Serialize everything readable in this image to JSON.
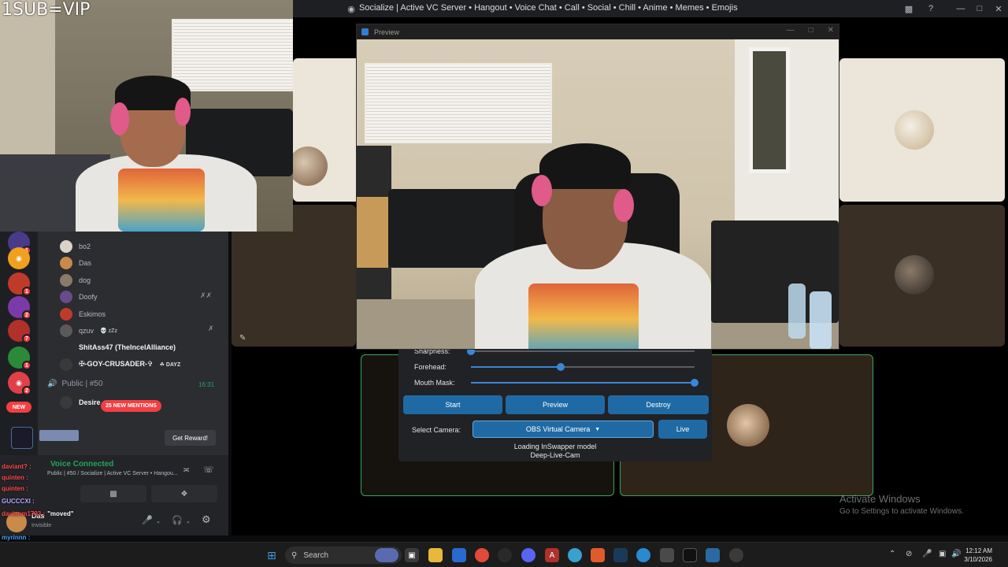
{
  "overlay": {
    "top_text": "1SUB=VIP"
  },
  "window": {
    "title": "Socialize | Active VC Server • Hangout • Voice Chat • Call • Social • Chill • Anime • Memes • Emojis"
  },
  "preview": {
    "title": "Preview"
  },
  "panel": {
    "sharpness_label": "Sharpness:",
    "forehead_label": "Forehead:",
    "mouth_mask_label": "Mouth Mask:",
    "forehead_value": 0.4,
    "mouth_mask_value": 1.0,
    "start_label": "Start",
    "preview_label": "Preview",
    "destroy_label": "Destroy",
    "select_camera_label": "Select Camera:",
    "camera_value": "OBS Virtual Camera",
    "live_label": "Live",
    "status_line1": "Loading InSwapper model",
    "status_line2": "Deep-Live-Cam"
  },
  "voice_users": [
    {
      "name": "bo2",
      "color": "#d9d3c9"
    },
    {
      "name": "Das",
      "color": "#c98a4a"
    },
    {
      "name": "dog",
      "color": "#8c7a68"
    },
    {
      "name": "Doofy",
      "color": "#6a4a8a"
    },
    {
      "name": "Eskimos",
      "color": "#c03a2a"
    },
    {
      "name": "qzuv",
      "color": "#5a5a5a",
      "tag": "💀 zZz"
    },
    {
      "name": "ShitAss47 (TheIncelAlliance)",
      "color": "#2b2d31",
      "bold": true
    },
    {
      "name": "✠-GOY-CRUSADER-✞",
      "color": "#3a3a3a",
      "bold": true,
      "tag": "☘ DAYZ"
    }
  ],
  "channel": {
    "name": "Public | #50",
    "time": "16:31",
    "next_user": "Desire",
    "mentions": "25 NEW MENTIONS"
  },
  "servers": {
    "new_label": "NEW",
    "badges": [
      "1",
      "1",
      "2",
      "7",
      "1",
      "2",
      "1"
    ]
  },
  "reward": {
    "button": "Get Reward!"
  },
  "voice": {
    "status": "Voice Connected",
    "sub": "Public | #50 / Socialize | Active VC Server • Hangou..."
  },
  "user": {
    "name": "Das",
    "status": "Invisible"
  },
  "chat_overlay": [
    {
      "user": "myrinnn :",
      "color": "#4aa3ff"
    },
    {
      "user": "myrinnn :",
      "color": "#4aa3ff"
    },
    {
      "user": "myrinnn :",
      "color": "#4aa3ff"
    },
    {
      "user": "davianm1793 :",
      "color": "#ff4a4a",
      "msg": "\"moved\""
    },
    {
      "user": "GUCCCXI :",
      "color": "#b7a4ff"
    },
    {
      "user": "quinten :",
      "color": "#ff4a4a"
    },
    {
      "user": "quinten :",
      "color": "#ff4a4a"
    },
    {
      "user": "daviant? :",
      "color": "#ff4a4a"
    }
  ],
  "activate": {
    "line1": "Activate Windows",
    "line2": "Go to Settings to activate Windows."
  },
  "taskbar": {
    "search_placeholder": "Search",
    "time": "12:12 AM",
    "date": "3/10/2026"
  }
}
